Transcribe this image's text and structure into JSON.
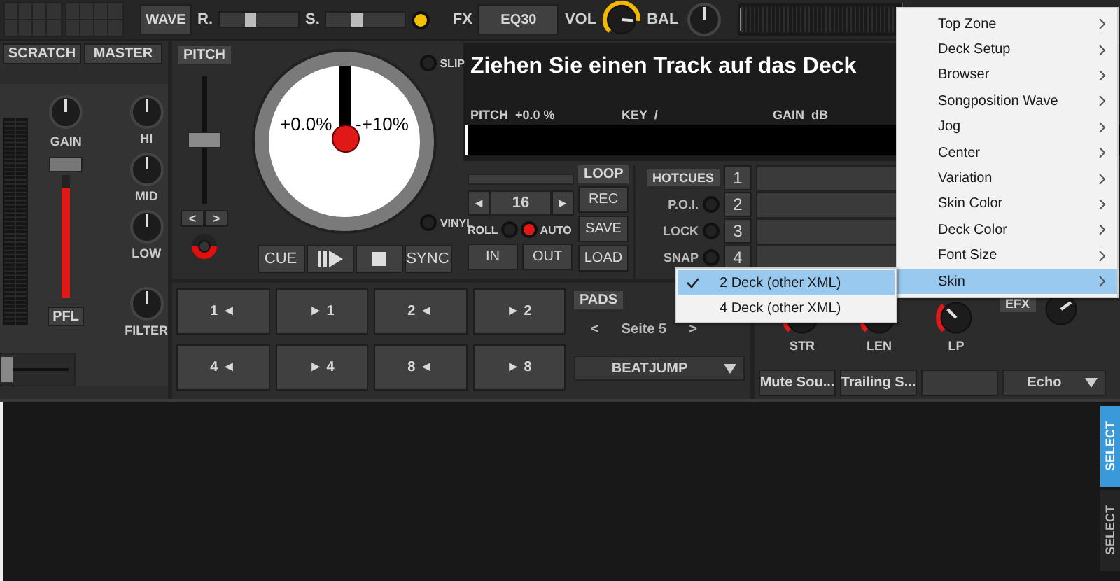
{
  "top_bar": {
    "wave_button": "WAVE",
    "sliders": [
      {
        "label": "R.",
        "level": 0.35
      },
      {
        "label": "S.",
        "level": 0.35
      }
    ],
    "indicator_on": true,
    "fx_label": "FX",
    "fx_button": "EQ30",
    "vol_label": "VOL",
    "bal_label": "BAL"
  },
  "mixer": {
    "buttons": [
      "SCRATCH",
      "MASTER"
    ],
    "gain": "GAIN",
    "eq": [
      "HI",
      "MID",
      "LOW"
    ],
    "filter": "FILTER",
    "pfl": "PFL",
    "fader": {
      "level": 0.9
    },
    "crossfader": {
      "level": 0
    }
  },
  "deck": {
    "pitch_label": "PITCH",
    "pitch_slider": {
      "level": 0.5
    },
    "nudge": [
      "<",
      ">"
    ],
    "slip": "SLIP",
    "vinyl": "VINYL",
    "jog_left": "+0.0%",
    "jog_right": "-+10%",
    "transport": [
      {
        "kind": "text",
        "label": "CUE"
      },
      {
        "kind": "playpause"
      },
      {
        "kind": "stop"
      },
      {
        "kind": "text",
        "label": "SYNC"
      }
    ],
    "pads": [
      "1 ◄",
      "► 1",
      "2 ◄",
      "► 2",
      "4 ◄",
      "► 4",
      "8 ◄",
      "► 8"
    ]
  },
  "display": {
    "title": "Ziehen Sie einen Track auf das Deck",
    "info": [
      "PITCH  +0.0 %",
      "KEY  /",
      "GAIN  dB"
    ]
  },
  "loop": {
    "label": "LOOP",
    "progress": {
      "level": 0
    },
    "prev": "◄",
    "size": "16",
    "next": "►",
    "roll": "ROLL",
    "roll_on": false,
    "auto": "AUTO",
    "auto_on": true,
    "in": "IN",
    "out": "OUT",
    "buttons": [
      "REC",
      "SAVE",
      "LOAD"
    ]
  },
  "hotcues": {
    "label": "HOTCUES",
    "rows": [
      {
        "number": "1"
      },
      {
        "option": "P.O.I.",
        "on": false,
        "number": "2"
      },
      {
        "option": "LOCK",
        "on": false,
        "number": "3"
      },
      {
        "option": "SNAP",
        "on": false,
        "number": "4"
      }
    ]
  },
  "pads_panel": {
    "label": "PADS",
    "prev": "<",
    "page": "Seite 5",
    "next": ">",
    "mode": "BEATJUMP"
  },
  "effects": {
    "label": "EFX",
    "knobs": [
      "STR",
      "LEN",
      "LP"
    ],
    "buttons": [
      "Mute Sou...",
      "Trailing S..."
    ],
    "effect": "Echo"
  },
  "browser": {
    "tabs": [
      {
        "label": "SELECT",
        "selected": true
      },
      {
        "label": "SELECT",
        "selected": false
      }
    ]
  },
  "context_menu": {
    "items": [
      {
        "label": "Top Zone",
        "selected": false
      },
      {
        "label": "Deck Setup",
        "selected": false
      },
      {
        "label": "Browser",
        "selected": false
      },
      {
        "label": "Songposition Wave",
        "selected": false
      },
      {
        "label": "Jog",
        "selected": false
      },
      {
        "label": "Center",
        "selected": false
      },
      {
        "label": "Variation",
        "selected": false
      },
      {
        "label": "Skin Color",
        "selected": false
      },
      {
        "label": "Deck Color",
        "selected": false
      },
      {
        "label": "Font Size",
        "selected": false
      },
      {
        "label": "Skin",
        "selected": true
      }
    ]
  },
  "submenu": {
    "items": [
      {
        "label": "2 Deck (other XML)",
        "checked": true,
        "selected": true
      },
      {
        "label": "4 Deck (other XML)",
        "checked": false,
        "selected": false
      }
    ]
  }
}
